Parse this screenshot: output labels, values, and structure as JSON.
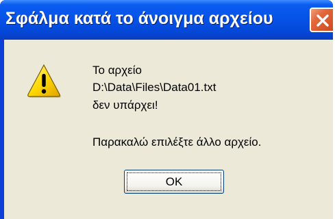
{
  "dialog": {
    "title": "Σφάλμα κατά το άνοιγμα αρχείου",
    "icon": "warning-icon",
    "message_lines": [
      "Το αρχείο",
      "D:\\Data\\Files\\Data01.txt",
      "δεν υπάρχει!",
      "Παρακαλώ επιλέξτε άλλο αρχείο."
    ],
    "ok_label": "OK",
    "close_icon": "close-icon"
  },
  "colors": {
    "titlebar": "#0653e8",
    "dialog_background": "#ece9d8",
    "close_button": "#e2683c",
    "warning_fill": "#ffd800"
  }
}
